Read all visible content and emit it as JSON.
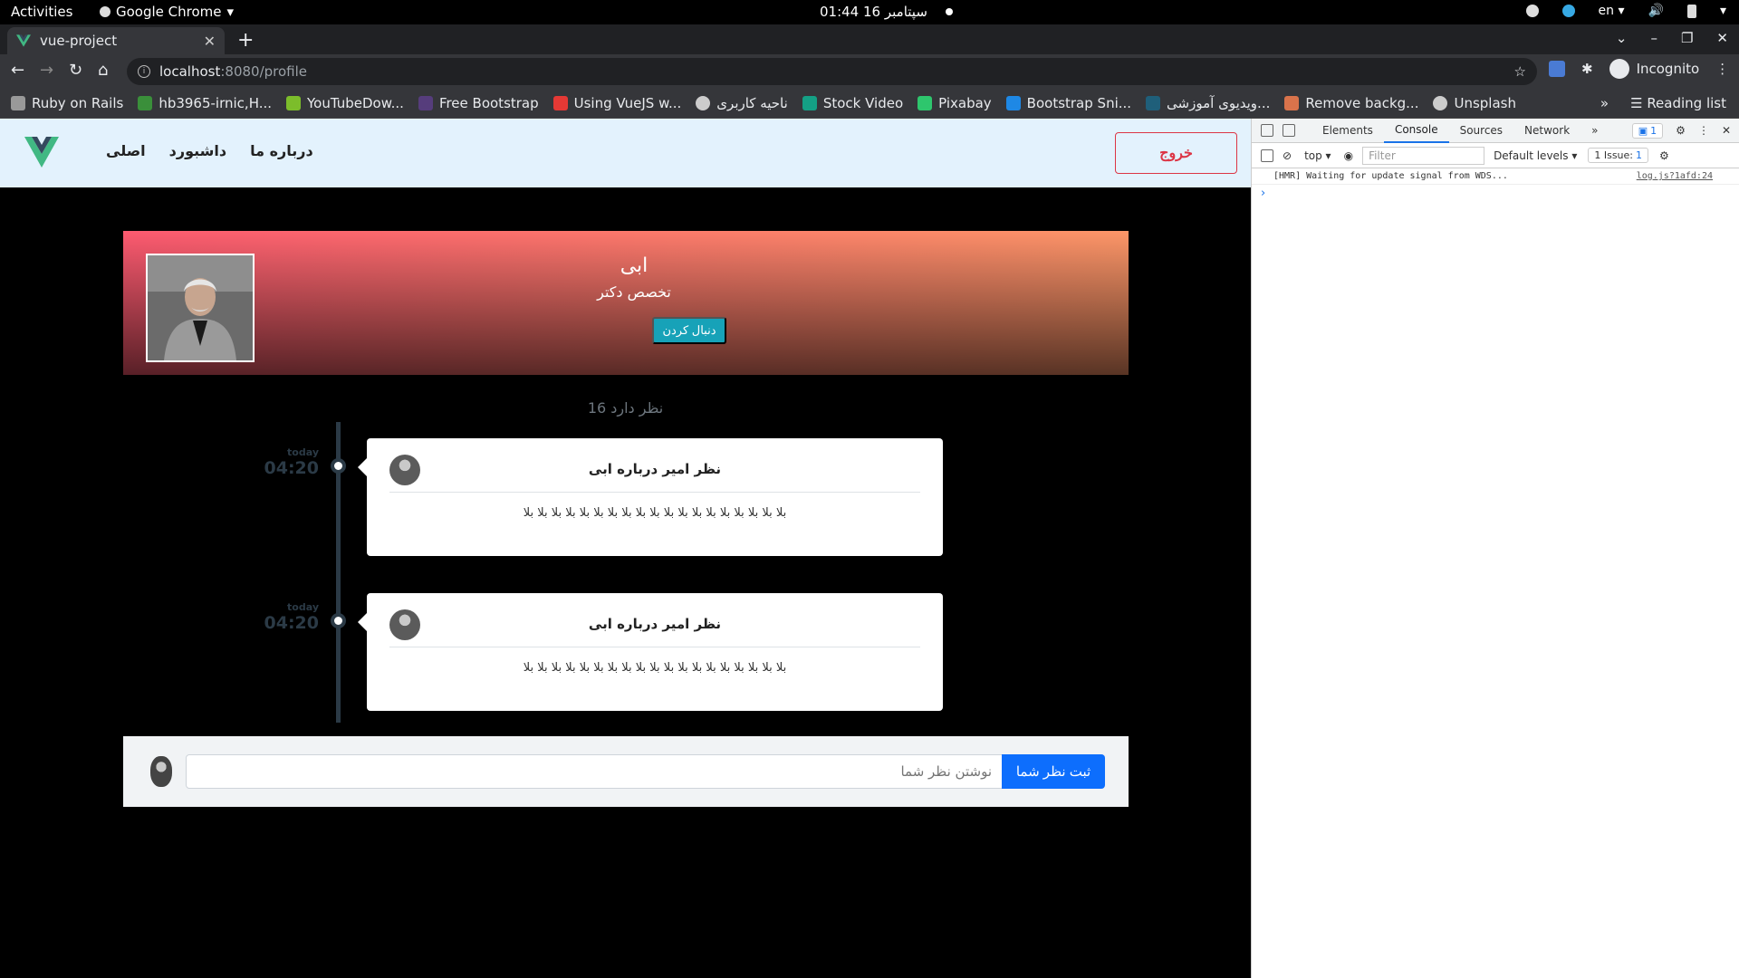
{
  "system_bar": {
    "activities": "Activities",
    "app_name": "Google Chrome",
    "clock": "سپتامبر 16  01:44",
    "lang": "en"
  },
  "browser": {
    "tab_title": "vue-project",
    "url_host": "localhost",
    "url_path": ":8080/profile",
    "profile_label": "Incognito",
    "reading_list": "Reading list",
    "bookmarks": [
      {
        "label": "Ruby on Rails",
        "color": "#999"
      },
      {
        "label": "hb3965-irnic,H...",
        "color": "#3a8f3a"
      },
      {
        "label": "YouTubeDow...",
        "color": "#7cbd2b"
      },
      {
        "label": "Free Bootstrap",
        "color": "#563d7c"
      },
      {
        "label": "Using VueJS w...",
        "color": "#e53935"
      },
      {
        "label": "ناحیه کاربری",
        "color": "#ccc"
      },
      {
        "label": "Stock Video",
        "color": "#14a085"
      },
      {
        "label": "Pixabay",
        "color": "#2ec66d"
      },
      {
        "label": "Bootstrap Sni...",
        "color": "#1e88e5"
      },
      {
        "label": "ویدیوی آموزشی...",
        "color": "#1f5f7a"
      },
      {
        "label": "Remove backg...",
        "color": "#d9734b"
      },
      {
        "label": "Unsplash",
        "color": "#ccc"
      }
    ]
  },
  "app": {
    "nav": [
      "اصلی",
      "داشبورد",
      "درباره ما"
    ],
    "logout": "خروج",
    "profile": {
      "name": "ابی",
      "title": "تخصص دکتر",
      "follow": "دنبال کردن"
    },
    "comment_count": "نظر دارد 16",
    "comments": [
      {
        "day": "today",
        "time": "04:20",
        "title": "نظر امیر درباره ابی",
        "body": "بلا بلا بلا بلا بلا بلا بلا بلا بلا بلا بلا بلا بلا بلا بلا بلا بلا بلا بلا"
      },
      {
        "day": "today",
        "time": "04:20",
        "title": "نظر امیر درباره ابی",
        "body": "بلا بلا بلا بلا بلا بلا بلا بلا بلا بلا بلا بلا بلا بلا بلا بلا بلا بلا بلا"
      }
    ],
    "comment_input": {
      "placeholder": "نوشتن نظر شما",
      "submit": "ثبت نظر شما"
    }
  },
  "devtools": {
    "tabs": [
      "Elements",
      "Console",
      "Sources",
      "Network"
    ],
    "active_tab": "Console",
    "badge": "1",
    "context": "top",
    "filter_placeholder": "Filter",
    "levels": "Default levels",
    "issues": "1 Issue:",
    "issues_count": "1",
    "log_message": "[HMR] Waiting for update signal from WDS...",
    "log_source": "log.js?1afd:24"
  },
  "colors": {
    "nav_bg": "#e3f2fd",
    "logout": "#dc3545",
    "follow": "#17a2b8",
    "submit": "#0d6efd",
    "gradient_start": "#fd5a70",
    "gradient_end": "#fd9668"
  }
}
